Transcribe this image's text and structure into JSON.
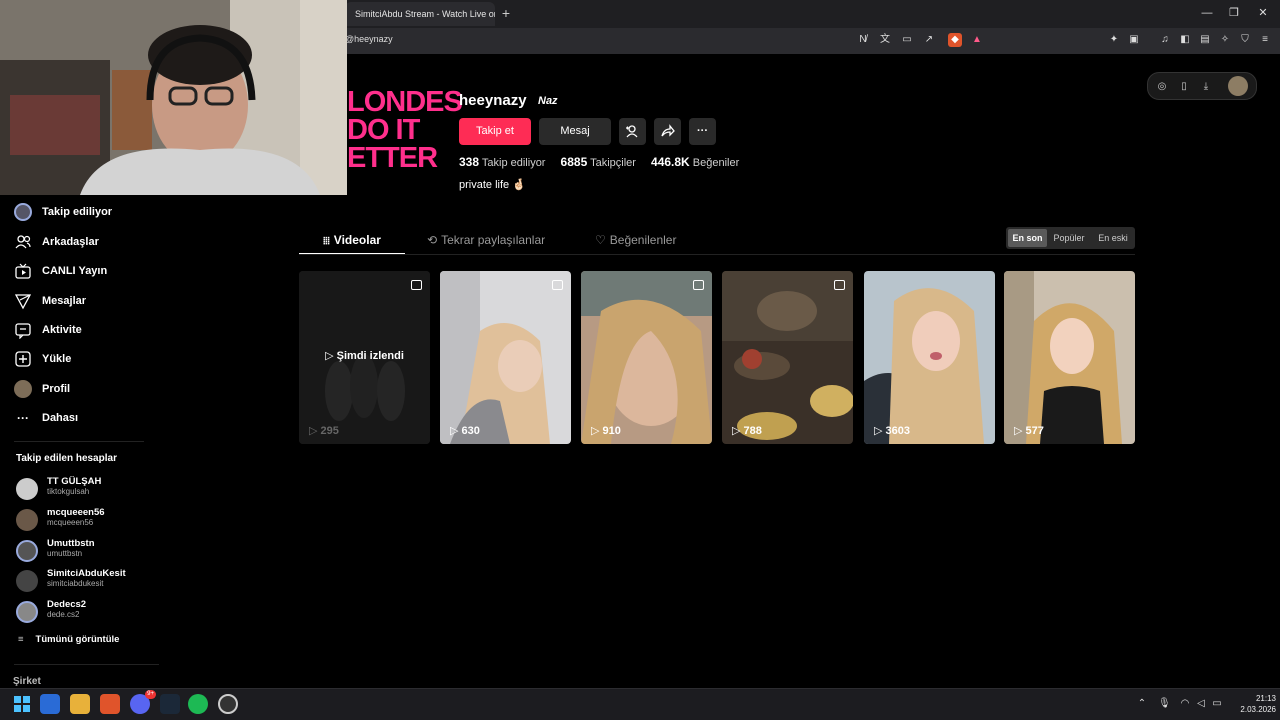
{
  "browser": {
    "tab_title": "SimitciAbdu Stream - Watch Live on K",
    "new_tab": "+",
    "url": "@heeynazy",
    "window_min": "—",
    "window_restore": "❐",
    "window_close": "✕"
  },
  "profile": {
    "cover_text": "LONDES\nDO IT\nETTER",
    "username": "heeynazy",
    "nickname": "Naz",
    "follow_label": "Takip et",
    "message_label": "Mesaj",
    "add_friend_icon": "person-plus-icon",
    "share_icon": "share-icon",
    "more_label": "···",
    "following_count": "338",
    "following_label": "Takip ediliyor",
    "followers_count": "6885",
    "followers_label": "Takipçiler",
    "likes_count": "446.8K",
    "likes_label": "Beğeniler",
    "bio": "private life 🤞🏻"
  },
  "tabs": {
    "videos": "Videolar",
    "reposts": "Tekrar paylaşılanlar",
    "liked": "Beğenilenler"
  },
  "sort": {
    "latest": "En son",
    "popular": "Popüler",
    "oldest": "En eski"
  },
  "videos": [
    {
      "count": "295",
      "overlay": "Şimdi izlendi"
    },
    {
      "count": "630"
    },
    {
      "count": "910"
    },
    {
      "count": "788"
    },
    {
      "count": "3603"
    },
    {
      "count": "577"
    }
  ],
  "sidebar": {
    "items": [
      {
        "label": "Takip ediliyor",
        "icon": "avatar-icon"
      },
      {
        "label": "Arkadaşlar",
        "icon": "friends-icon"
      },
      {
        "label": "CANLI Yayın",
        "icon": "live-tv-icon"
      },
      {
        "label": "Mesajlar",
        "icon": "send-icon"
      },
      {
        "label": "Aktivite",
        "icon": "activity-icon"
      },
      {
        "label": "Yükle",
        "icon": "upload-icon"
      },
      {
        "label": "Profil",
        "icon": "profile-avatar-icon"
      },
      {
        "label": "Dahası",
        "icon": "more-icon"
      }
    ],
    "following_title": "Takip edilen hesaplar",
    "accounts": [
      {
        "name": "TT GÜLŞAH",
        "handle": "tiktokgulsah"
      },
      {
        "name": "mcqueeen56",
        "handle": "mcqueeen56"
      },
      {
        "name": "Umuttbstn",
        "handle": "umuttbstn"
      },
      {
        "name": "SimitciAbduKesit",
        "handle": "simitciabdukesit"
      },
      {
        "name": "Dedecs2",
        "handle": "dede.cs2"
      }
    ],
    "see_all": "Tümünü görüntüle",
    "company": "Şirket"
  },
  "taskbar": {
    "time": "21:13",
    "date": "2.03.2026",
    "discord_badge": "9+"
  },
  "colors": {
    "accent": "#fe2c55",
    "background": "#000000",
    "cover_pink": "#ff2f8c"
  }
}
